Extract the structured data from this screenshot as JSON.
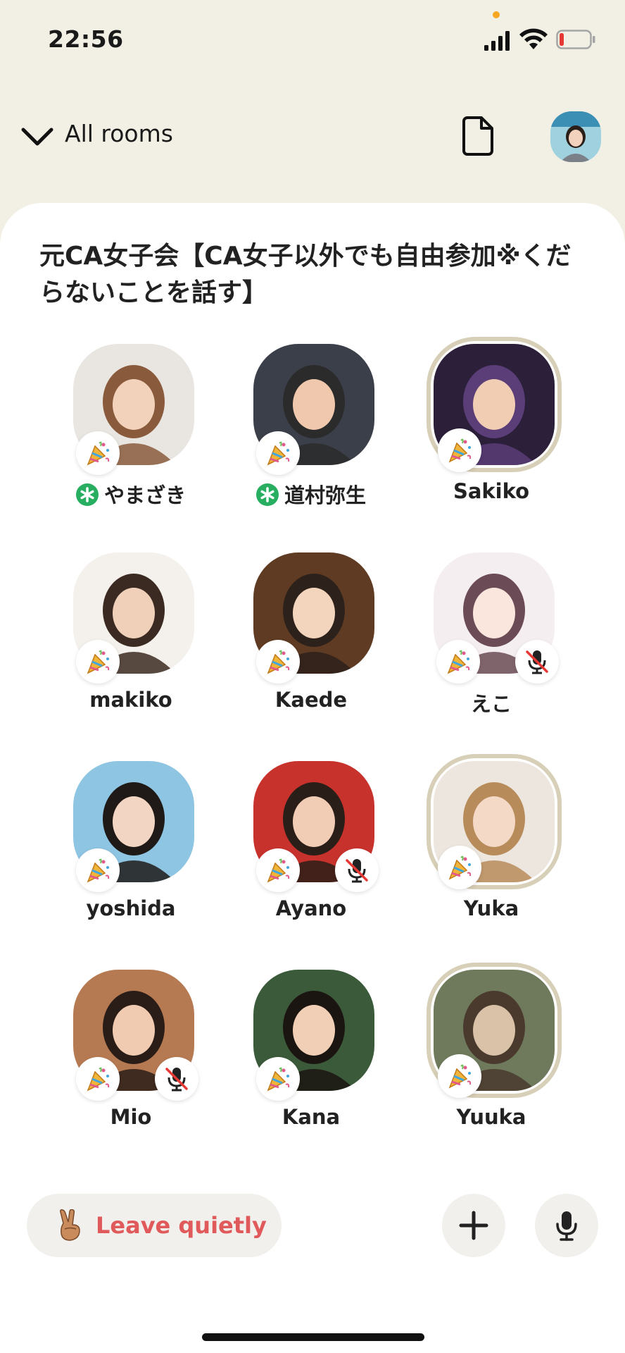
{
  "status_bar": {
    "time": "22:56"
  },
  "header": {
    "back_label": "All rooms"
  },
  "room": {
    "title": "元CA女子会【CA女子以外でも自由参加※くだらないことを話す】"
  },
  "speakers": [
    {
      "name": "やまざき",
      "moderator": true,
      "muted": false,
      "ring": false,
      "colors": [
        "#e9e6e1",
        "#8a5a3c",
        "#f2d2bb"
      ]
    },
    {
      "name": "道村弥生",
      "moderator": true,
      "muted": false,
      "ring": false,
      "colors": [
        "#3a3f4a",
        "#2b2b2b",
        "#f0c8ad"
      ]
    },
    {
      "name": "Sakiko",
      "moderator": false,
      "muted": false,
      "ring": true,
      "colors": [
        "#2b1f3a",
        "#5b3d78",
        "#f1cdb4"
      ]
    },
    {
      "name": "makiko",
      "moderator": false,
      "muted": false,
      "ring": false,
      "colors": [
        "#f4f1ec",
        "#3b2a22",
        "#f0d0b8"
      ]
    },
    {
      "name": "Kaede",
      "moderator": false,
      "muted": false,
      "ring": false,
      "colors": [
        "#5e3b22",
        "#2d211b",
        "#f3d4bd"
      ]
    },
    {
      "name": "えこ",
      "moderator": false,
      "muted": true,
      "ring": false,
      "colors": [
        "#f5eef0",
        "#6b4b55",
        "#fbe6de"
      ]
    },
    {
      "name": "yoshida",
      "moderator": false,
      "muted": false,
      "ring": false,
      "colors": [
        "#8ec5e2",
        "#1f1a17",
        "#f2d5c2"
      ]
    },
    {
      "name": "Ayano",
      "moderator": false,
      "muted": true,
      "ring": false,
      "colors": [
        "#c8322c",
        "#2a1e18",
        "#f2cdb6"
      ]
    },
    {
      "name": "Yuka",
      "moderator": false,
      "muted": false,
      "ring": true,
      "colors": [
        "#ece6de",
        "#b88b5a",
        "#f4d9c6"
      ]
    },
    {
      "name": "Mio",
      "moderator": false,
      "muted": true,
      "ring": false,
      "colors": [
        "#b67a52",
        "#2a1d17",
        "#f0cbb2"
      ]
    },
    {
      "name": "Kana",
      "moderator": false,
      "muted": false,
      "ring": false,
      "colors": [
        "#3b5a3a",
        "#1b1512",
        "#f1cfb6"
      ]
    },
    {
      "name": "Yuuka",
      "moderator": false,
      "muted": false,
      "ring": true,
      "colors": [
        "#6f7a5c",
        "#4a3a2e",
        "#d9c2a8"
      ]
    }
  ],
  "bottom_bar": {
    "leave_label": "Leave quietly"
  },
  "colors": {
    "background": "#f2f0e4",
    "leave_text": "#e0595b",
    "moderator_green": "#27ae60",
    "ring": "#d8cfb8"
  }
}
